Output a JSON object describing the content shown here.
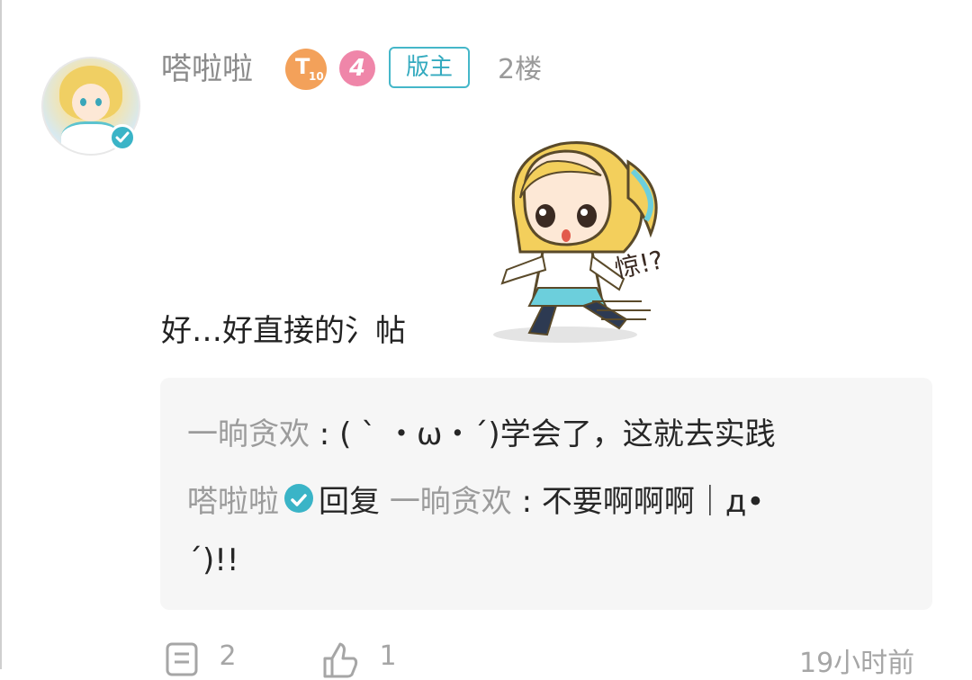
{
  "post": {
    "username": "嗒啦啦",
    "badge_t10_main": "T",
    "badge_t10_sub": "10",
    "level": "4",
    "role": "版主",
    "floor": "2楼",
    "text": "好…好直接的氵帖"
  },
  "sticker": {
    "caption": "惊!?"
  },
  "replies": [
    {
      "user": "一晌贪欢",
      "sep": " : ",
      "text": "( ` ・ω・´)学会了，这就去实践"
    },
    {
      "user": "嗒啦啦",
      "action": "回复",
      "target": "一晌贪欢",
      "sep": " : ",
      "text_line1": "不要啊啊啊｜д•",
      "text_line2": "´)!!"
    }
  ],
  "footer": {
    "comments": "2",
    "likes": "1",
    "time": "19小时前"
  },
  "colors": {
    "accent": "#3ab4c7",
    "reply_bg": "#f6f6f6",
    "level_pink": "#ef86a9",
    "badge_orange": "#f3a15a"
  }
}
